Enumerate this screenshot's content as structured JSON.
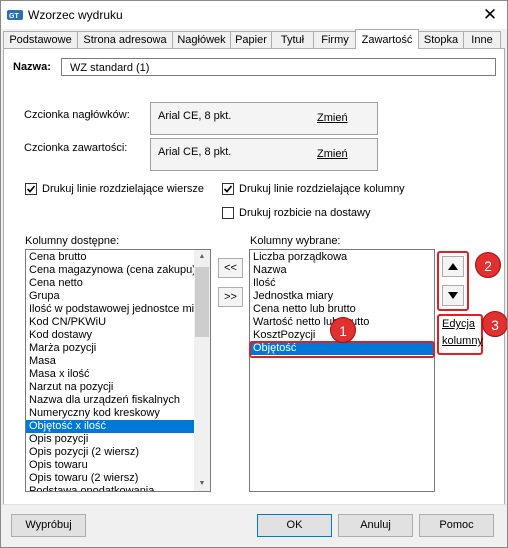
{
  "window": {
    "title": "Wzorzec wydruku",
    "close_glyph": "✕"
  },
  "tabs": [
    {
      "label": "Podstawowe",
      "active": false
    },
    {
      "label": "Strona adresowa",
      "active": false
    },
    {
      "label": "Nagłówek",
      "active": false
    },
    {
      "label": "Papier",
      "active": false
    },
    {
      "label": "Tytuł",
      "active": false
    },
    {
      "label": "Firmy",
      "active": false
    },
    {
      "label": "Zawartość",
      "active": true
    },
    {
      "label": "Stopka",
      "active": false
    },
    {
      "label": "Inne",
      "active": false
    }
  ],
  "name": {
    "label": "Nazwa:",
    "value": "WZ standard (1)"
  },
  "fonts": {
    "header_label": "Czcionka nagłówków:",
    "header_value": "Arial CE, 8 pkt.",
    "content_label": "Czcionka zawartości:",
    "content_value": "Arial CE, 8 pkt.",
    "change_label": "Zmień"
  },
  "checkboxes": {
    "row_lines": {
      "label": "Drukuj linie rozdzielające wiersze",
      "checked": true
    },
    "col_lines": {
      "label": "Drukuj linie rozdzielające kolumny",
      "checked": true
    },
    "deliveries": {
      "label": "Drukuj rozbicie na dostawy",
      "checked": false
    }
  },
  "available": {
    "label": "Kolumny dostępne:",
    "items": [
      "Cena brutto",
      "Cena magazynowa (cena zakupu)",
      "Cena netto",
      "Grupa",
      "Ilość w podstawowej jednostce miary",
      "Kod CN/PKWiU",
      "Kod dostawy",
      "Marża pozycji",
      "Masa",
      "Masa x ilość",
      "Narzut na pozycji",
      "Nazwa dla urządzeń fiskalnych",
      "Numeryczny kod kreskowy",
      "Objętość x ilość",
      "Opis pozycji",
      "Opis pozycji (2 wiersz)",
      "Opis towaru",
      "Opis towaru (2 wiersz)",
      "Podstawa opodatkowania"
    ],
    "selected_index": 13
  },
  "move": {
    "add_label": ">>",
    "remove_label": "<<"
  },
  "selected": {
    "label": "Kolumny wybrane:",
    "items": [
      "Liczba porządkowa",
      "Nazwa",
      "Ilość",
      "Jednostka miary",
      "Cena netto lub brutto",
      "Wartość netto lub brutto",
      "KosztPozycji",
      "Objętość"
    ],
    "selected_index": 7
  },
  "order": {
    "up_icon": "triangle-up-icon",
    "down_icon": "triangle-down-icon"
  },
  "edit_columns": {
    "line1": "Edycja",
    "line2": "kolumny"
  },
  "callouts": {
    "one": "1",
    "two": "2",
    "three": "3",
    "color": "#e02020"
  },
  "footer": {
    "preview": "Wypróbuj",
    "ok": "OK",
    "cancel": "Anuluj",
    "help": "Pomoc"
  },
  "colors": {
    "selection": "#0078d7",
    "badge": "#e03030"
  }
}
